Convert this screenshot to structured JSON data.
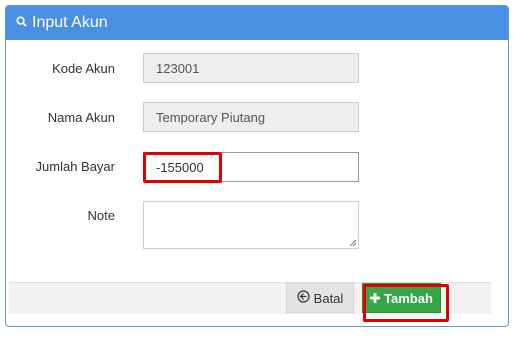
{
  "panel": {
    "title": "Input Akun",
    "icon": "search-icon"
  },
  "form": {
    "kode_akun": {
      "label": "Kode Akun",
      "value": "123001"
    },
    "nama_akun": {
      "label": "Nama Akun",
      "value": "Temporary Piutang"
    },
    "jumlah_bayar": {
      "label": "Jumlah Bayar",
      "value": "-155000"
    },
    "note": {
      "label": "Note",
      "value": ""
    }
  },
  "footer": {
    "batal_label": "Batal",
    "batal_icon": "arrow-left-circle-icon",
    "tambah_label": "Tambah",
    "tambah_icon": "plus-icon"
  },
  "colors": {
    "header": "#4a90e2",
    "tambah": "#37a649",
    "highlight": "#e00000"
  }
}
